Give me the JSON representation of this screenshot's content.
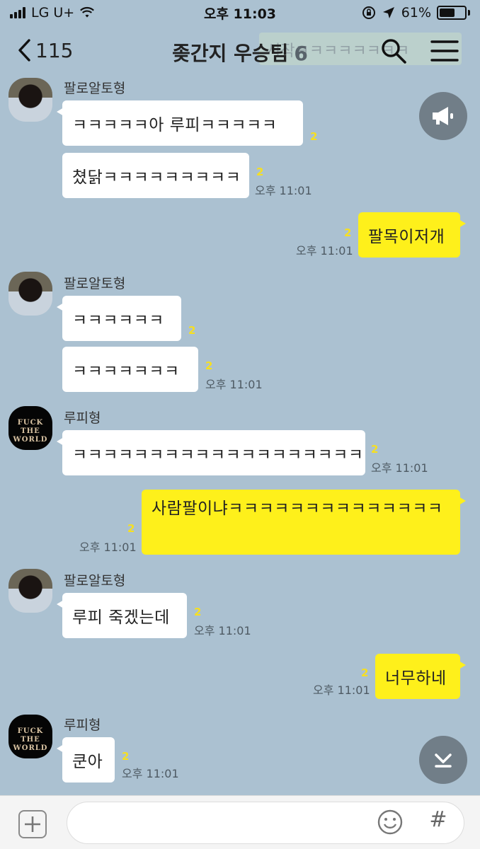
{
  "status_bar": {
    "carrier": "LG U+",
    "time": "오후 11:03",
    "battery_percent": "61%",
    "battery_level": 0.61
  },
  "header": {
    "back_count": "115",
    "title": "좆간지 우승팀",
    "member_count": "6",
    "banner_preview": "시작ㅋㅋㅋㅋㅋㅋㅋㅋ"
  },
  "messages": [
    {
      "sender": "팔로알토형",
      "texts": [
        "ㅋㅋㅋㅋㅋ아 루피ㅋㅋㅋㅋㅋ",
        "쳤닭ㅋㅋㅋㅋㅋㅋㅋㅋㅋ"
      ],
      "unread": [
        "2",
        "2"
      ],
      "time": "오후 11:01"
    },
    {
      "sender": "me",
      "texts": [
        "팔목이저개"
      ],
      "unread": [
        "2"
      ],
      "time": "오후 11:01"
    },
    {
      "sender": "팔로알토형",
      "texts": [
        "ㅋㅋㅋㅋㅋㅋ",
        "ㅋㅋㅋㅋㅋㅋㅋ"
      ],
      "unread": [
        "2",
        "2"
      ],
      "time": "오후 11:01"
    },
    {
      "sender": "루피형",
      "texts": [
        "ㅋㅋㅋㅋㅋㅋㅋㅋㅋㅋㅋㅋㅋㅋㅋㅋㅋㅋㅋ"
      ],
      "unread": [
        "2"
      ],
      "time": "오후 11:01"
    },
    {
      "sender": "me",
      "texts": [
        "사람팔이냐ㅋㅋㅋㅋㅋㅋㅋㅋㅋㅋㅋㅋㅋㅋ"
      ],
      "unread": [
        "2"
      ],
      "time": "오후 11:01"
    },
    {
      "sender": "팔로알토형",
      "texts": [
        "루피 죽겠는데"
      ],
      "unread": [
        "2"
      ],
      "time": "오후 11:01"
    },
    {
      "sender": "me",
      "texts": [
        "너무하네"
      ],
      "unread": [
        "2"
      ],
      "time": "오후 11:01"
    },
    {
      "sender": "루피형",
      "texts": [
        "쿤아"
      ],
      "unread": [
        "2"
      ],
      "time": "오후 11:01"
    }
  ],
  "avatar_logo": "FUCK THE WORLD",
  "icons": [
    "back-chevron-icon",
    "search-icon",
    "menu-icon",
    "megaphone-icon",
    "scroll-down-icon",
    "plus-icon",
    "emoji-icon",
    "hash-icon",
    "wifi-icon",
    "lock-rotation-icon",
    "location-icon",
    "battery-icon"
  ],
  "colors": {
    "background": "#abc1d1",
    "my_bubble": "#fef01b",
    "their_bubble": "#ffffff",
    "unread": "#f6df21"
  }
}
